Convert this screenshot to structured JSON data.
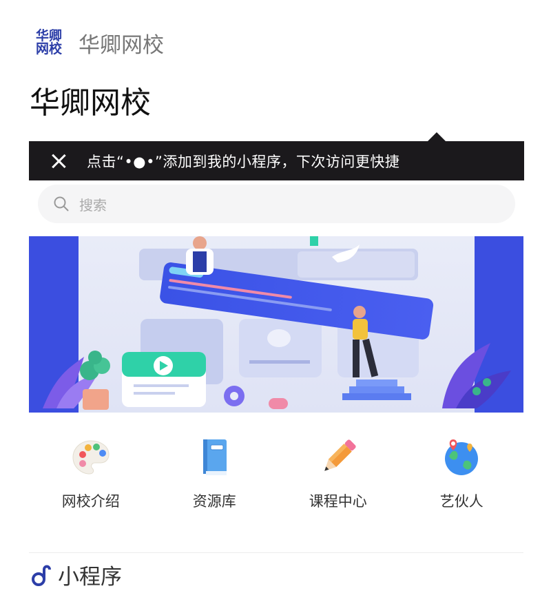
{
  "header": {
    "logo_line1": "华卿",
    "logo_line2": "网校",
    "title": "华卿网校"
  },
  "page": {
    "title": "华卿网校"
  },
  "tooltip": {
    "message": "点击“•●•”添加到我的小程序，下次访问更快捷"
  },
  "search": {
    "placeholder": "搜索"
  },
  "nav": [
    {
      "label": "网校介绍",
      "icon": "palette-icon"
    },
    {
      "label": "资源库",
      "icon": "book-icon"
    },
    {
      "label": "课程中心",
      "icon": "pencil-icon"
    },
    {
      "label": "艺伙人",
      "icon": "globe-icon"
    }
  ],
  "footer": {
    "label": "小程序"
  },
  "colors": {
    "brand": "#2c3ea8",
    "tooltip_bg": "#1b191c",
    "banner_blue": "#3b4ee0"
  }
}
